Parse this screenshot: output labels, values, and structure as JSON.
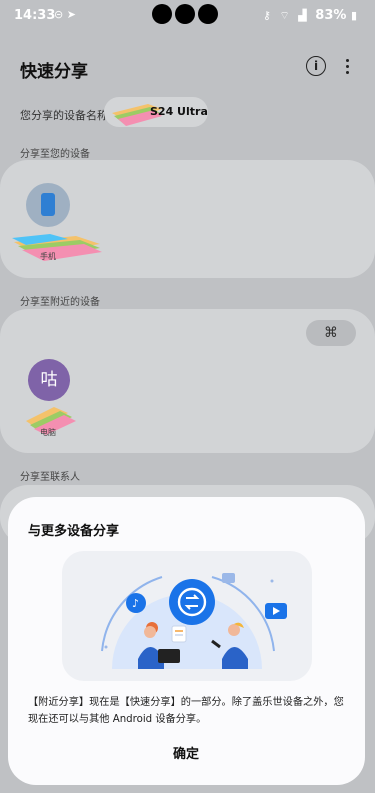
{
  "status_bar": {
    "time": "14:33",
    "battery": "83%",
    "left_icons": [
      "message-icon",
      "send-icon"
    ],
    "right_icons": [
      "vpn-key-icon",
      "wifi-icon",
      "signal-icon",
      "battery-icon"
    ]
  },
  "app": {
    "title": "快速分享",
    "actions": [
      "info-icon",
      "more-vert-icon"
    ]
  },
  "device_name": {
    "label": "您分享的设备名称",
    "value": "S24 Ultra"
  },
  "sections": {
    "own_devices": {
      "label": "分享至您的设备",
      "device_caption": "手机"
    },
    "nearby_devices": {
      "label": "分享至附近的设备",
      "device_avatar_text": "咕",
      "device_caption": "电脑",
      "qr_icon": "qr-code-icon"
    },
    "contacts": {
      "label": "分享至联系人"
    }
  },
  "dialog": {
    "title": "与更多设备分享",
    "body": "【附近分享】现在是【快速分享】的一部分。除了盖乐世设备之外，您现在还可以与其他 Android 设备分享。",
    "confirm_label": "确定"
  },
  "colors": {
    "scrim_background": "#bfc1c4",
    "card_background": "#d2d4d6",
    "dialog_background": "#fbfbfd",
    "accent_blue": "#1a73e8",
    "avatar_purple": "#7f63a8"
  }
}
